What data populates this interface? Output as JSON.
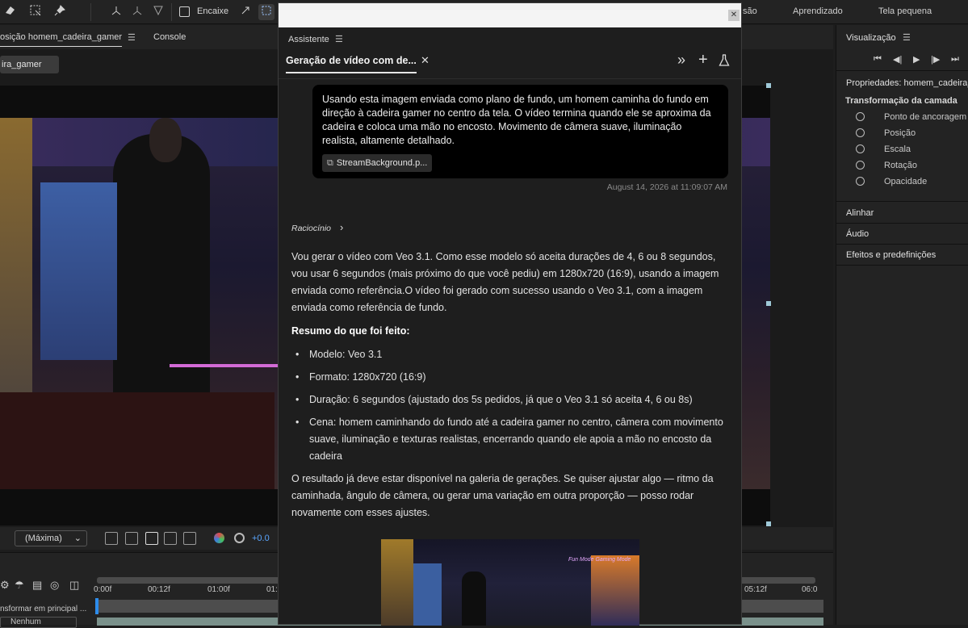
{
  "toolbar": {
    "snap_label": "Encaixe",
    "workspaces": [
      "Aprendizado",
      "Tela pequena"
    ],
    "workspace_partial": "são"
  },
  "composition": {
    "tab_label": "osição homem_cadeira_gamer",
    "console_tab": "Console",
    "chip_label": "ira_gamer",
    "zoom_select": "(Máxima)",
    "exposure_value": "+0.0"
  },
  "timeline": {
    "ticks": [
      "0:00f",
      "00:12f",
      "01:00f",
      "01:",
      "05:12f",
      "06:0"
    ],
    "track_label": "nsformar em principal ...",
    "blend_select": "Nenhum"
  },
  "right_panel": {
    "preview_title": "Visualização",
    "properties_title": "Propriedades: homem_cadeira_",
    "transform_title": "Transformação da camada",
    "transform_items": [
      "Ponto de ancoragem",
      "Posição",
      "Escala",
      "Rotação",
      "Opacidade"
    ],
    "sections": [
      "Alinhar",
      "Áudio",
      "Efeitos e predefinições"
    ]
  },
  "assistant": {
    "panel_title": "Assistente",
    "tab_title": "Geração de vídeo com de...",
    "prompt": "Usando esta imagem enviada como plano de fundo, um homem caminha do fundo em direção à cadeira gamer no centro da tela. O vídeo termina quando ele se aproxima da cadeira e coloca uma mão no encosto. Movimento de câmera suave, iluminação realista, altamente detalhado.",
    "attachment": "StreamBackground.p...",
    "timestamp": "August 14, 2026 at 11:09:07 AM",
    "reasoning_label": "Raciocínio",
    "paragraph1": "Vou gerar o vídeo com Veo 3.1. Como esse modelo só aceita durações de 4, 6 ou 8 segundos, vou usar 6 segundos (mais próximo do que você pediu) em 1280x720 (16:9), usando a imagem enviada como referência.O vídeo foi gerado com sucesso usando o Veo 3.1, com a imagem enviada como referência de fundo.",
    "summary_heading": "Resumo do que foi feito:",
    "bullets": [
      "Modelo: Veo 3.1",
      "Formato: 1280x720 (16:9)",
      "Duração: 6 segundos (ajustado dos 5s pedidos, já que o Veo 3.1 só aceita 4, 6 ou 8s)",
      "Cena: homem caminhando do fundo até a cadeira gamer no centro, câmera com movimento suave, iluminação e texturas realistas, encerrando quando ele apoia a mão no encosto da cadeira"
    ],
    "paragraph2": "O resultado já deve estar disponível na galeria de gerações. Se quiser ajustar algo — ritmo da caminhada, ângulo de câmera, ou gerar uma variação em outra proporção — posso rodar novamente com esses ajustes.",
    "thumbnail_caption": "Fun Mode Gaming Mode"
  },
  "colors": {
    "accent": "#2d8ceb",
    "panel_bg": "#232323",
    "bubble_bg": "#000000"
  }
}
